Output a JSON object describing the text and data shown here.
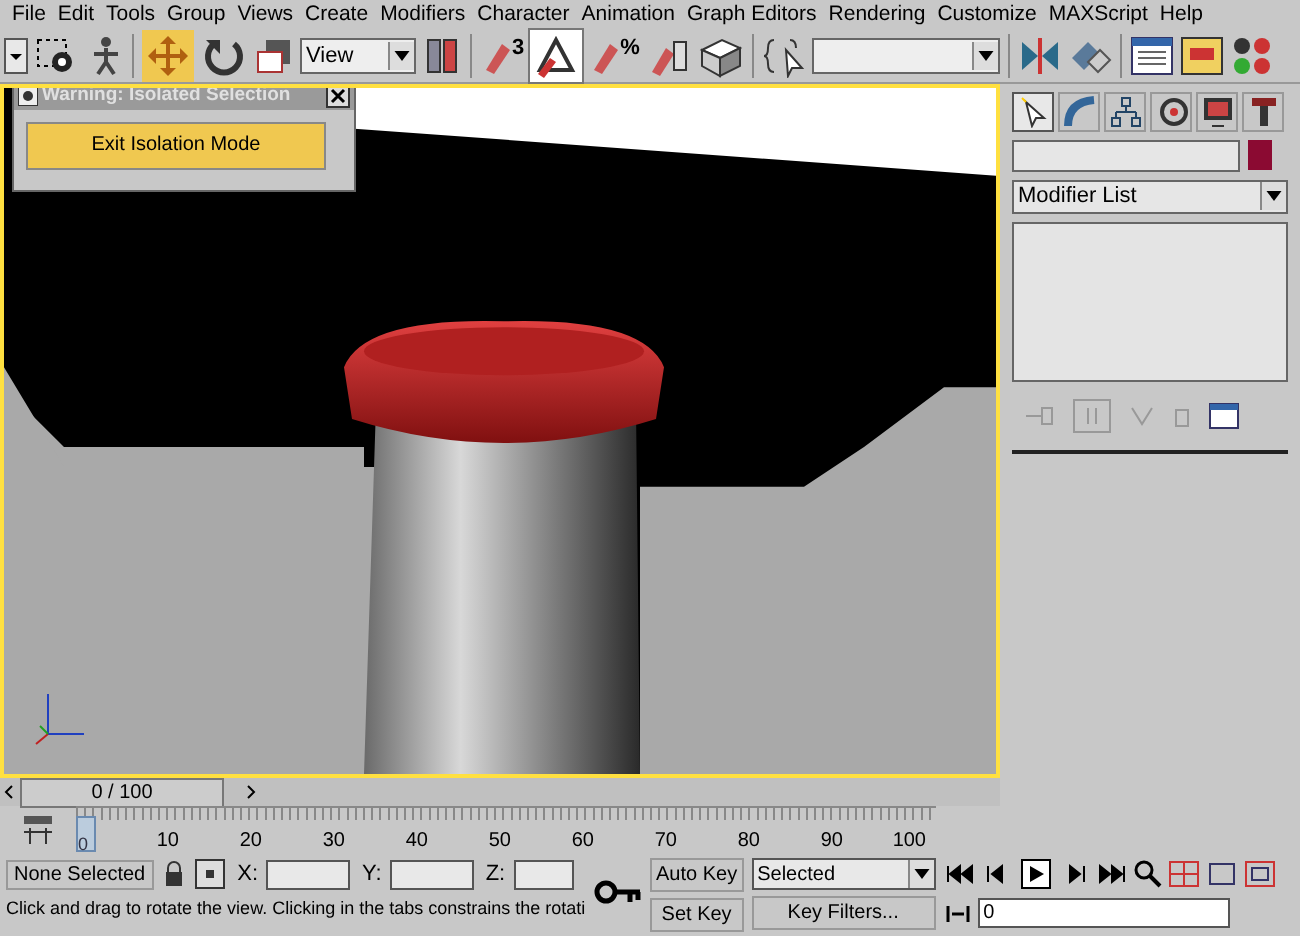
{
  "menu": [
    "File",
    "Edit",
    "Tools",
    "Group",
    "Views",
    "Create",
    "Modifiers",
    "Character",
    "Animation",
    "Graph Editors",
    "Rendering",
    "Customize",
    "MAXScript",
    "Help"
  ],
  "toolbar": {
    "reference_coord": "View",
    "snap_labels": [
      "3",
      "%"
    ]
  },
  "dialog": {
    "title": "Warning: Isolated Selection",
    "button": "Exit Isolation Mode"
  },
  "command_panel": {
    "tabs": [
      {
        "kind": "create",
        "selected": true
      },
      {
        "kind": "modify",
        "selected": false
      },
      {
        "kind": "hierarchy",
        "selected": false
      },
      {
        "kind": "motion",
        "selected": false
      },
      {
        "kind": "display",
        "selected": false
      },
      {
        "kind": "utilities",
        "selected": false
      }
    ],
    "modifier_list": "Modifier List"
  },
  "time_slider": {
    "label": "0 / 100",
    "level": 0
  },
  "timeline": {
    "ticks": [
      "10",
      "20",
      "30",
      "40",
      "50",
      "60",
      "70",
      "80",
      "90",
      "100"
    ],
    "start": "0"
  },
  "status": {
    "selection": "None Selected",
    "x_label": "X:",
    "y_label": "Y:",
    "z_label": "Z:",
    "prompt": "Click and drag to rotate the view.  Clicking in the tabs constrains the rotati",
    "auto_key": "Auto Key",
    "set_key": "Set Key",
    "key_mode": "Selected",
    "key_filters": "Key Filters...",
    "frame": "0"
  }
}
